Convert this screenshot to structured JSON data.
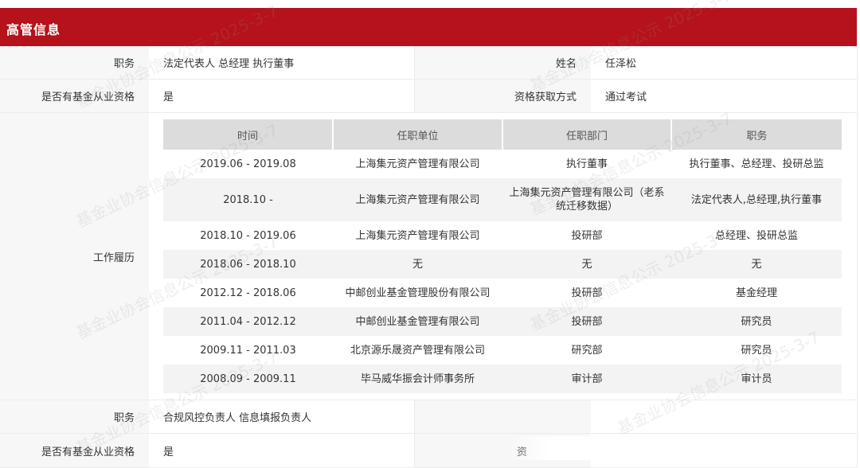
{
  "header": {
    "title": "高管信息"
  },
  "exec1": {
    "position_label": "职务",
    "position_value": "法定代表人 总经理 执行董事",
    "name_label": "姓名",
    "name_value": "任泽松",
    "qual_label": "是否有基金从业资格",
    "qual_value": "是",
    "qual_method_label": "资格获取方式",
    "qual_method_value": "通过考试",
    "history_label": "工作履历",
    "history": {
      "columns": [
        "时间",
        "任职单位",
        "任职部门",
        "职务"
      ],
      "rows": [
        {
          "time": "2019.06 - 2019.08",
          "org": "上海集元资产管理有限公司",
          "dept": "执行董事",
          "title": "执行董事、总经理、投研总监"
        },
        {
          "time": "2018.10 -",
          "org": "上海集元资产管理有限公司",
          "dept": "上海集元资产管理有限公司（老系统迁移数据）",
          "title": "法定代表人,总经理,执行董事"
        },
        {
          "time": "2018.10 - 2019.06",
          "org": "上海集元资产管理有限公司",
          "dept": "投研部",
          "title": "总经理、投研总监"
        },
        {
          "time": "2018.06 - 2018.10",
          "org": "无",
          "dept": "无",
          "title": "无"
        },
        {
          "time": "2012.12 - 2018.06",
          "org": "中邮创业基金管理股份有限公司",
          "dept": "投研部",
          "title": "基金经理"
        },
        {
          "time": "2011.04 - 2012.12",
          "org": "中邮创业基金管理有限公司",
          "dept": "投研部",
          "title": "研究员"
        },
        {
          "time": "2009.11 - 2011.03",
          "org": "北京源乐晟资产管理有限公司",
          "dept": "研究部",
          "title": "研究员"
        },
        {
          "time": "2008.09 - 2009.11",
          "org": "毕马威华振会计师事务所",
          "dept": "审计部",
          "title": "审计员"
        }
      ]
    }
  },
  "exec2": {
    "position_label": "职务",
    "position_value": "合规风控负责人 信息填报负责人",
    "qual_label": "是否有基金从业资格",
    "qual_value": "是",
    "qual_method_label_partial": "资"
  },
  "watermark": {
    "text": "基金业协会信息公示 2025-3-7"
  },
  "colors": {
    "header_bg": "#b5121b",
    "label_bg": "#f7f7f7",
    "table_head_bg": "#dcdcdc",
    "stripe_bg": "#f3f3f3"
  }
}
